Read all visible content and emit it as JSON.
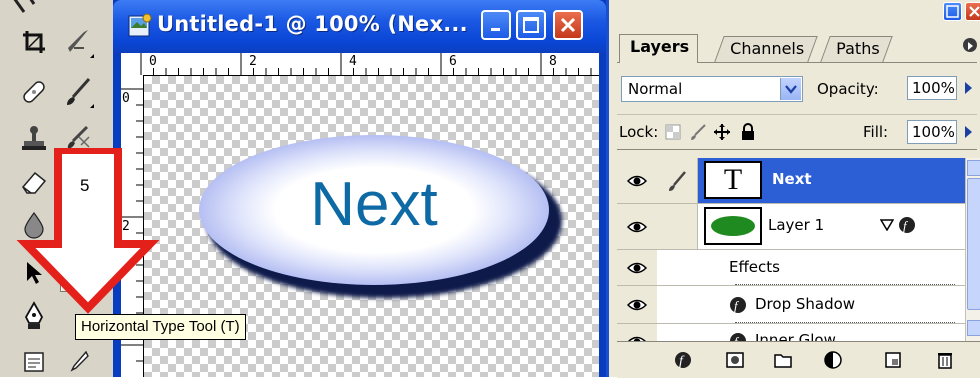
{
  "toolbox": {
    "tools": [
      "move-tool",
      "crop-tool",
      "slice-tool",
      "healing-brush-tool",
      "brush-tool",
      "clone-stamp-tool",
      "history-brush-tool",
      "eraser-tool",
      "gradient-tool",
      "blur-tool",
      "path-selection-tool",
      "horizontal-type-tool",
      "pen-tool",
      "notes-tool",
      "eyedropper-tool"
    ],
    "selected_tool": "horizontal-type-tool",
    "selected_glyph": "T"
  },
  "document": {
    "title": "Untitled-1 @ 100% (Nex...",
    "ruler_h_labels": [
      "0",
      "2",
      "4",
      "6",
      "8"
    ],
    "ruler_v_labels": [
      "0",
      "2"
    ],
    "button_text": "Next",
    "button_text_color": "#0e6aa4"
  },
  "layers_panel": {
    "tabs": [
      "Layers",
      "Channels",
      "Paths"
    ],
    "active_tab": "Layers",
    "blend_mode": "Normal",
    "opacity_label": "Opacity:",
    "opacity_value": "100%",
    "lock_label": "Lock:",
    "fill_label": "Fill:",
    "fill_value": "100%",
    "layers": [
      {
        "name": "Next",
        "type": "text",
        "thumb_glyph": "T",
        "selected": true
      },
      {
        "name": "Layer 1",
        "type": "shape",
        "has_effects": true,
        "selected": false
      }
    ],
    "effects_label": "Effects",
    "effects": [
      "Drop Shadow",
      "Inner Glow"
    ]
  },
  "annotations": {
    "step_number": "5",
    "tooltip": "Horizontal Type Tool (T)",
    "arrow_color": "#e4201b"
  },
  "colors": {
    "titlebar": "#1a58e3",
    "selection": "#2c5fd6",
    "toolbox_bg": "#d8d4c8"
  }
}
